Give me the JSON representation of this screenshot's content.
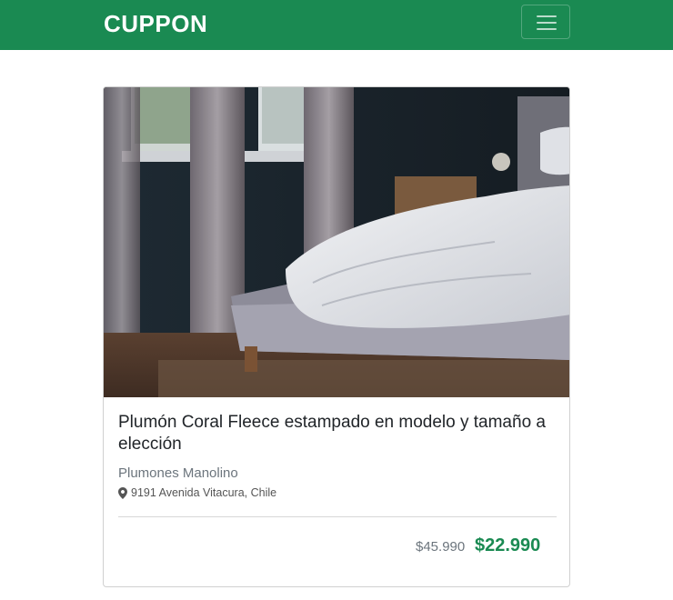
{
  "navbar": {
    "brand": "CUPPON",
    "menu_icon": "hamburger-menu-icon",
    "background_color": "#1a8a52"
  },
  "deal": {
    "image_alt": "bedroom with bed and duvet",
    "title": "Plumón Coral Fleece estampado en modelo y tamaño a elección",
    "vendor": "Plumones Manolino",
    "address_icon": "map-marker-icon",
    "address": "9191 Avenida Vitacura, Chile",
    "old_price": "$45.990",
    "new_price": "$22.990",
    "price_color": "#1a8a52"
  }
}
